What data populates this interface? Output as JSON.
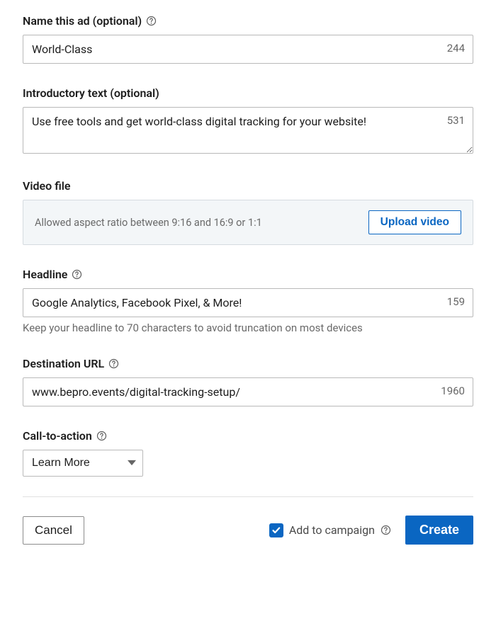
{
  "adName": {
    "label": "Name this ad (optional)",
    "value": "World-Class",
    "counter": "244"
  },
  "introText": {
    "label": "Introductory text (optional)",
    "value": "Use free tools and get world-class digital tracking for your website!",
    "counter": "531"
  },
  "videoFile": {
    "label": "Video file",
    "hint": "Allowed aspect ratio between 9:16 and 16:9 or 1:1",
    "buttonLabel": "Upload video"
  },
  "headline": {
    "label": "Headline",
    "value": "Google Analytics, Facebook Pixel, & More!",
    "counter": "159",
    "helper": "Keep your headline to 70 characters to avoid truncation on most devices"
  },
  "destinationUrl": {
    "label": "Destination URL",
    "value": "www.bepro.events/digital-tracking-setup/",
    "counter": "1960"
  },
  "cta": {
    "label": "Call-to-action",
    "selected": "Learn More"
  },
  "footer": {
    "cancel": "Cancel",
    "addToCampaign": "Add to campaign",
    "addToCampaignChecked": true,
    "create": "Create"
  }
}
